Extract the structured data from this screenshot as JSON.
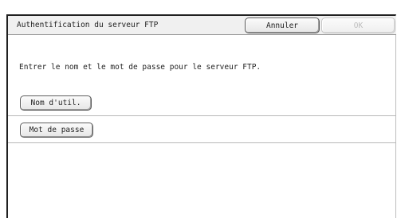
{
  "dialog": {
    "title": "Authentification du serveur FTP",
    "cancel_label": "Annuler",
    "ok_label": "OK",
    "instruction": "Entrer le nom et le mot de passe pour le serveur FTP.",
    "fields": [
      {
        "label": "Nom d'util."
      },
      {
        "label": "Mot de passe"
      }
    ]
  }
}
